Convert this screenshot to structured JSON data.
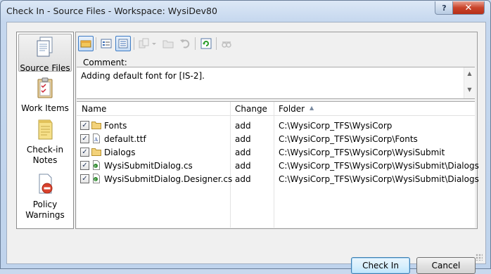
{
  "window": {
    "title": "Check In - Source Files - Workspace: WysiDev80",
    "help_label": "?",
    "close_label": "✕"
  },
  "nav": {
    "items": [
      {
        "label": "Source Files",
        "icon": "source-files-icon",
        "selected": true
      },
      {
        "label": "Work Items",
        "icon": "work-items-icon",
        "selected": false
      },
      {
        "label": "Check-in Notes",
        "icon": "checkin-notes-icon",
        "selected": false
      },
      {
        "label": "Policy Warnings",
        "icon": "policy-warnings-icon",
        "selected": false
      }
    ]
  },
  "toolbar": {
    "buttons": [
      {
        "icon": "shelve-icon",
        "state": "on"
      },
      {
        "icon": "flat-view-icon",
        "state": "normal"
      },
      {
        "icon": "folder-view-icon",
        "state": "on"
      },
      {
        "icon": "compare-icon",
        "state": "disabled"
      },
      {
        "icon": "open-icon",
        "state": "disabled"
      },
      {
        "icon": "undo-icon",
        "state": "disabled"
      },
      {
        "icon": "refresh-icon",
        "state": "normal"
      },
      {
        "icon": "get-latest-icon",
        "state": "disabled"
      }
    ]
  },
  "comment": {
    "label": "Comment:",
    "value": "Adding default font for [IS-2]."
  },
  "files": {
    "columns": {
      "name": "Name",
      "change": "Change",
      "folder": "Folder"
    },
    "sort_indicator": "▲",
    "rows": [
      {
        "checked": true,
        "icon": "folder",
        "name": "Fonts",
        "change": "add",
        "folder": "C:\\WysiCorp_TFS\\WysiCorp"
      },
      {
        "checked": true,
        "icon": "font-file",
        "name": "default.ttf",
        "change": "add",
        "folder": "C:\\WysiCorp_TFS\\WysiCorp\\Fonts"
      },
      {
        "checked": true,
        "icon": "folder",
        "name": "Dialogs",
        "change": "add",
        "folder": "C:\\WysiCorp_TFS\\WysiCorp\\WysiSubmit"
      },
      {
        "checked": true,
        "icon": "csharp-file",
        "name": "WysiSubmitDialog.cs",
        "change": "add",
        "folder": "C:\\WysiCorp_TFS\\WysiCorp\\WysiSubmit\\Dialogs"
      },
      {
        "checked": true,
        "icon": "csharp-file",
        "name": "WysiSubmitDialog.Designer.cs",
        "change": "add",
        "folder": "C:\\WysiCorp_TFS\\WysiCorp\\WysiSubmit\\Dialogs"
      }
    ]
  },
  "buttons": {
    "check_in": "Check In",
    "cancel": "Cancel"
  }
}
